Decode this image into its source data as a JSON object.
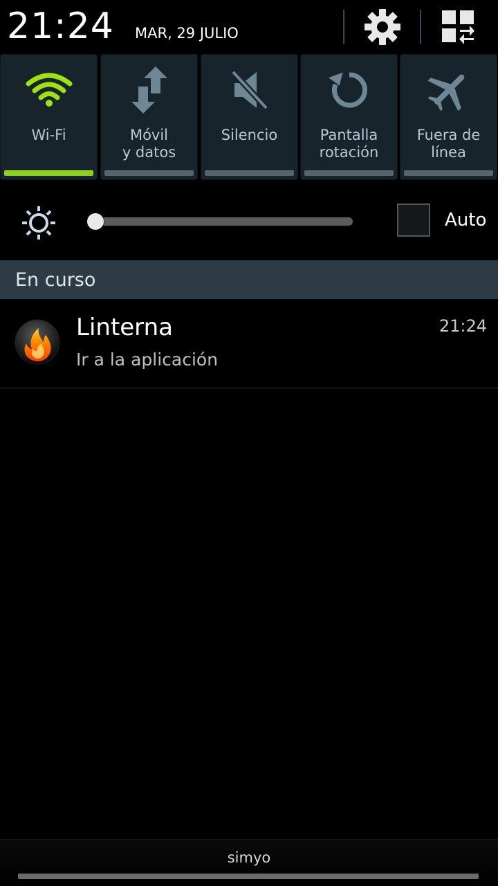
{
  "status": {
    "time": "21:24",
    "date": "MAR, 29 JULIO"
  },
  "header_icons": {
    "settings": "gear-icon",
    "edit_toggles": "grid-edit-icon"
  },
  "quick_toggles": [
    {
      "label_line1": "Wi-Fi",
      "label_line2": "",
      "icon": "wifi-icon",
      "active": true
    },
    {
      "label_line1": "Móvil",
      "label_line2": "y datos",
      "icon": "mobile-data-icon",
      "active": false
    },
    {
      "label_line1": "Silencio",
      "label_line2": "",
      "icon": "mute-icon",
      "active": false
    },
    {
      "label_line1": "Pantalla",
      "label_line2": "rotación",
      "icon": "rotation-icon",
      "active": false
    },
    {
      "label_line1": "Fuera de",
      "label_line2": "línea",
      "icon": "airplane-icon",
      "active": false
    }
  ],
  "brightness": {
    "level": 0,
    "auto_label": "Auto",
    "auto_checked": false
  },
  "section": {
    "title": "En curso"
  },
  "notification": {
    "title": "Linterna",
    "subtitle": "Ir a la aplicación",
    "time": "21:24",
    "icon": "flame-icon"
  },
  "footer": {
    "carrier": "simyo"
  },
  "colors": {
    "active_accent": "#8ed11b",
    "tile_bg": "#17242c",
    "icon_color": "#6f8794"
  }
}
